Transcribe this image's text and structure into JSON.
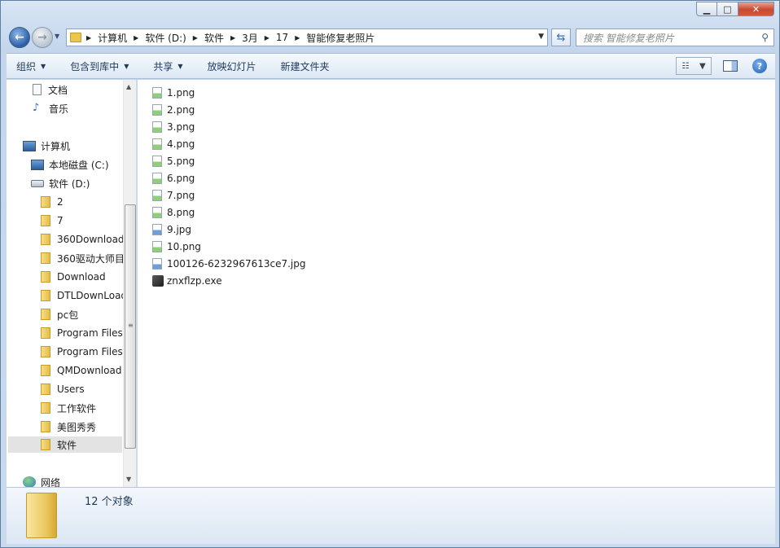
{
  "window": {
    "controls": {
      "minimize": "▁",
      "maximize": "□",
      "close": "✕"
    }
  },
  "address": {
    "breadcrumbs": [
      "计算机",
      "软件 (D:)",
      "软件",
      "3月",
      "17",
      "智能修复老照片"
    ]
  },
  "search": {
    "placeholder": "搜索 智能修复老照片"
  },
  "toolbar": {
    "organize": "组织",
    "include_library": "包含到库中",
    "share": "共享",
    "slideshow": "放映幻灯片",
    "new_folder": "新建文件夹"
  },
  "nav": {
    "documents": "文档",
    "music": "音乐",
    "computer": "计算机",
    "drive_c": "本地磁盘 (C:)",
    "drive_d": "软件 (D:)",
    "folders": [
      "2",
      "7",
      "360Download",
      "360驱动大师目",
      "Download",
      "DTLDownLoad",
      "pc包",
      "Program Files",
      "Program Files",
      "QMDownload",
      "Users",
      "工作软件",
      "美图秀秀",
      "软件"
    ],
    "network": "网络"
  },
  "files": [
    {
      "name": "1.png",
      "type": "png"
    },
    {
      "name": "2.png",
      "type": "png"
    },
    {
      "name": "3.png",
      "type": "png"
    },
    {
      "name": "4.png",
      "type": "png"
    },
    {
      "name": "5.png",
      "type": "png"
    },
    {
      "name": "6.png",
      "type": "png"
    },
    {
      "name": "7.png",
      "type": "png"
    },
    {
      "name": "8.png",
      "type": "png"
    },
    {
      "name": "9.jpg",
      "type": "jpg"
    },
    {
      "name": "10.png",
      "type": "png"
    },
    {
      "name": "100126-6232967613ce7.jpg",
      "type": "jpg"
    },
    {
      "name": "znxflzp.exe",
      "type": "exe"
    }
  ],
  "details": {
    "count": "12 个对象"
  }
}
